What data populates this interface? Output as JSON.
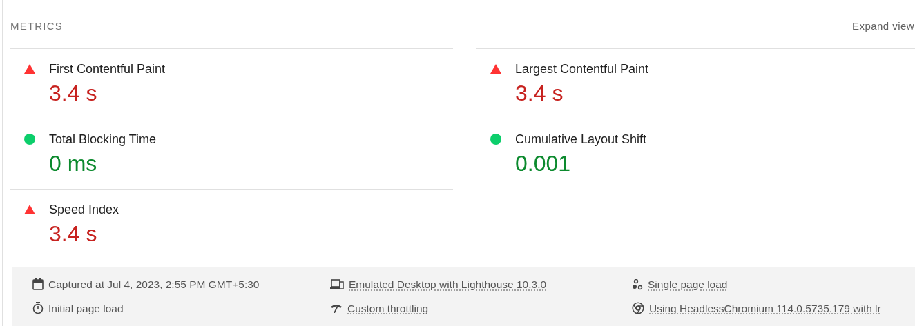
{
  "header": {
    "title": "METRICS",
    "action": "Expand view"
  },
  "metrics": [
    {
      "label": "First Contentful Paint",
      "value": "3.4 s",
      "kind": "fail"
    },
    {
      "label": "Largest Contentful Paint",
      "value": "3.4 s",
      "kind": "fail"
    },
    {
      "label": "Total Blocking Time",
      "value": "0 ms",
      "kind": "pass"
    },
    {
      "label": "Cumulative Layout Shift",
      "value": "0.001",
      "kind": "pass"
    },
    {
      "label": "Speed Index",
      "value": "3.4 s",
      "kind": "fail"
    }
  ],
  "footer": [
    {
      "text": "Captured at Jul 4, 2023, 2:55 PM GMT+5:30",
      "linked": false
    },
    {
      "text": "Emulated Desktop with Lighthouse 10.3.0",
      "linked": true
    },
    {
      "text": "Single page load",
      "linked": true
    },
    {
      "text": "Initial page load",
      "linked": false
    },
    {
      "text": "Custom throttling",
      "linked": true
    },
    {
      "text": "Using HeadlessChromium 114.0.5735.179 with lr",
      "linked": true
    }
  ]
}
